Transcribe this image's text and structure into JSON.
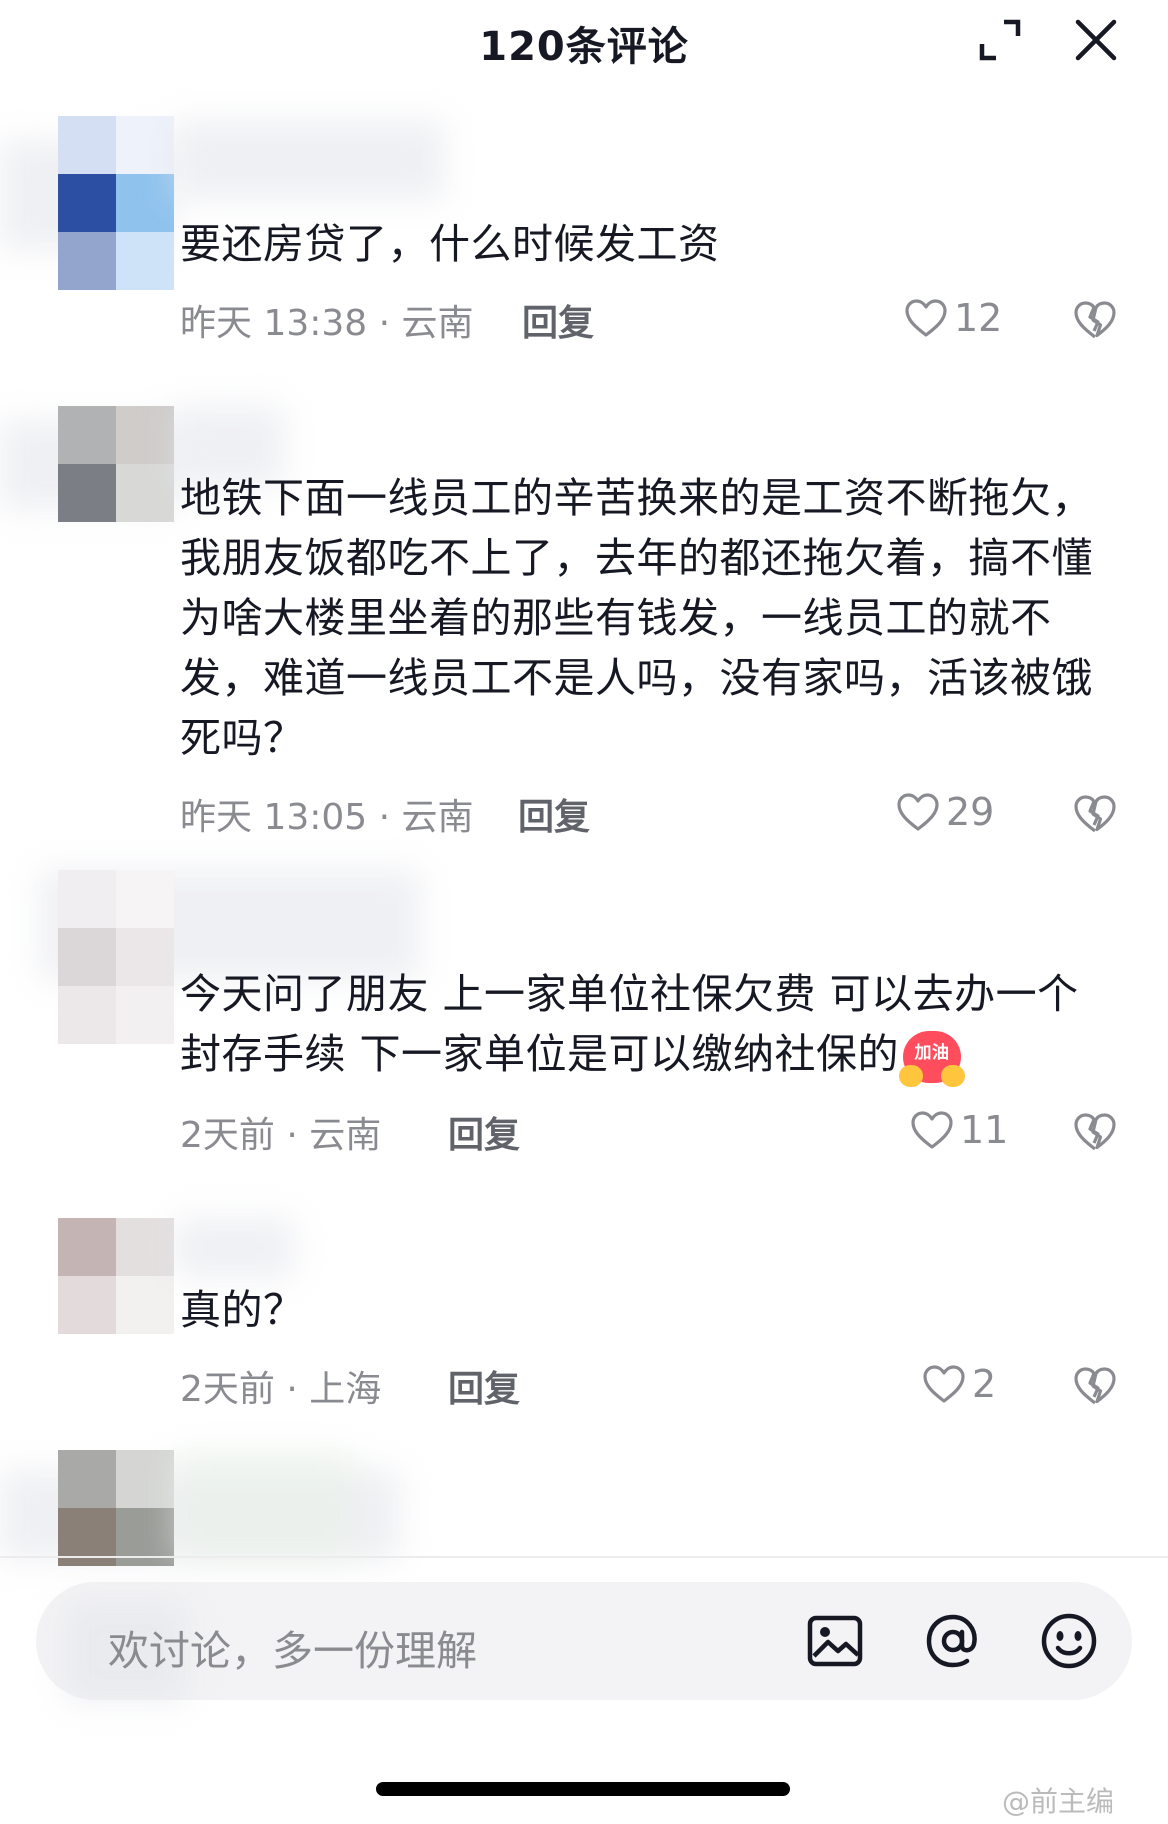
{
  "header": {
    "title": "120条评论"
  },
  "comments": [
    {
      "text": "要还房贷了，什么时候发工资",
      "time_location": "昨天 13:38 · 云南",
      "reply_label": "回复",
      "likes": "12",
      "avatar_colors": [
        "#d4dff3",
        "#eef2fb",
        "#2d4fa3",
        "#8fc3ee",
        "#93a5cd",
        "#cfe3f8"
      ]
    },
    {
      "text": "地铁下面一线员工的辛苦换来的是工资不断拖欠，我朋友饭都吃不上了，去年的都还拖欠着，搞不懂为啥大楼里坐着的那些有钱发，一线员工的就不发，难道一线员工不是人吗，没有家吗，活该被饿死吗？",
      "time_location": "昨天 13:05 · 云南",
      "reply_label": "回复",
      "likes": "29",
      "avatar_colors": [
        "#b1b2b3",
        "#cfccca",
        "#7c7e85",
        "#d8d9d7"
      ]
    },
    {
      "text": "今天问了朋友 上一家单位社保欠费 可以去办一个封存手续 下一家单位是可以缴纳社保的",
      "emoji_label": "加油",
      "time_location": "2天前 · 云南",
      "reply_label": "回复",
      "likes": "11",
      "avatar_colors": [
        "#f0eef0",
        "#f6f4f5",
        "#dbd6d8",
        "#ebe6e8",
        "#ece8ea",
        "#f3f0f1"
      ]
    },
    {
      "text": "真的？",
      "time_location": "2天前 · 上海",
      "reply_label": "回复",
      "likes": "2",
      "avatar_colors": [
        "#c4b4b4",
        "#e4dfdf",
        "#e3dadb",
        "#f3f0f0"
      ]
    },
    {
      "avatar_colors": [
        "#a9aaa8",
        "#d5d6d4",
        "#8a8077",
        "#9a9c98"
      ]
    }
  ],
  "input_bar": {
    "placeholder": "欢讨论，多一份理解",
    "icons": [
      "image-icon",
      "at-icon",
      "emoji-icon"
    ]
  },
  "watermark": "@前主编"
}
